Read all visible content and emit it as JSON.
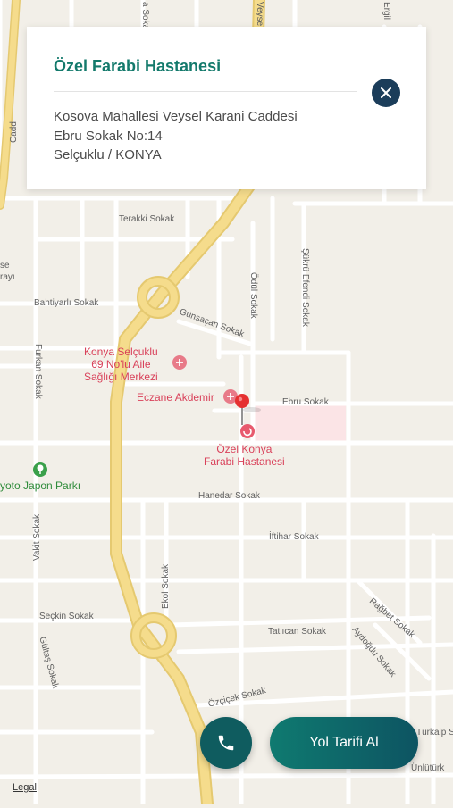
{
  "card": {
    "title": "Özel Farabi Hastanesi",
    "address_lines": [
      "Kosova Mahallesi Veysel Karani Caddesi",
      "Ebru Sokak No:14",
      "Selçuklu / KONYA"
    ],
    "close_icon": "close-icon"
  },
  "map": {
    "streets": {
      "terakki": "Terakki Sokak",
      "bahtiyarli": "Bahtiyarlı Sokak",
      "gunsacan": "Günsaçan Sokak",
      "odul": "Ödül Sokak",
      "sukru": "Şükrü Efendi Sokak",
      "furkan": "Furkan Sokak",
      "ebru": "Ebru Sokak",
      "hanedar": "Hanedar Sokak",
      "iftihar": "İftihar Sokak",
      "vakit": "Vakit Sokak",
      "ekol": "Ekol Sokak",
      "seckin": "Seçkin Sokak",
      "gultas": "Gültaş Sokak",
      "tatlican": "Tatlıcan Sokak",
      "ragbet": "Rağbet Sokak",
      "aydogdu": "Aydoğdu Sokak",
      "ozcicek": "Özçiçek Sokak",
      "turkalp": "Türkalp S",
      "unlutork": "Ünlütürk",
      "veyse": "Veyse",
      "ergil": "Ergil",
      "asokak": "a Sokak",
      "se": "se",
      "rayi": "rayı",
      "cadd": "Cadd"
    },
    "pois": {
      "aile_sagligi": [
        "Konya Selçuklu",
        "69 No'lu Aile",
        "Sağlığı Merkezi"
      ],
      "eczane": "Eczane Akdemir",
      "hastane": [
        "Özel Konya",
        "Farabi Hastanesi"
      ],
      "park": "yoto Japon Parkı"
    },
    "colors": {
      "road": "#ffffff",
      "major_road": "#f5dc8c",
      "highlight": "#fbe4e6",
      "poi": "#d9415a",
      "pin": "#e53030"
    },
    "icons": {
      "pin": "map-pin-icon",
      "hospital": "hospital-icon",
      "pharmacy": "pharmacy-icon",
      "park": "park-icon"
    }
  },
  "buttons": {
    "route_label": "Yol Tarifi Al",
    "phone_icon": "phone-icon"
  },
  "footer": {
    "legal": "Legal"
  }
}
